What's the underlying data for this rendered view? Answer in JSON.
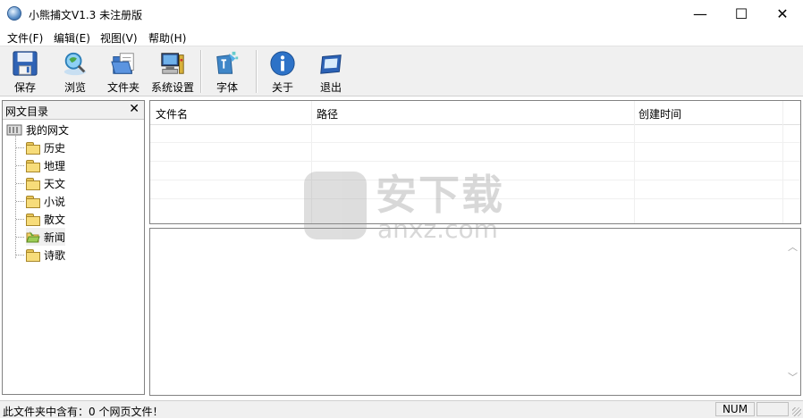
{
  "window": {
    "title": "小熊捕文V1.3 未注册版",
    "minimize_glyph": "—",
    "maximize_glyph": "☐",
    "close_glyph": "✕"
  },
  "menu": [
    "文件(F)",
    "编辑(E)",
    "视图(V)",
    "帮助(H)"
  ],
  "toolbar": {
    "save": "保存",
    "browse": "浏览",
    "folder": "文件夹",
    "settings": "系统设置",
    "font": "字体",
    "about": "关于",
    "exit": "退出"
  },
  "left_panel": {
    "title": "网文目录",
    "close_glyph": "✕",
    "root": "我的网文",
    "items": [
      "历史",
      "地理",
      "天文",
      "小说",
      "散文",
      "新闻",
      "诗歌"
    ]
  },
  "list": {
    "columns": [
      "文件名",
      "路径",
      "创建时间"
    ]
  },
  "status": {
    "text": "此文件夹中含有：0 个网页文件！",
    "num": "NUM"
  },
  "watermark": {
    "title": "安下载",
    "sub": "anxz.com"
  }
}
